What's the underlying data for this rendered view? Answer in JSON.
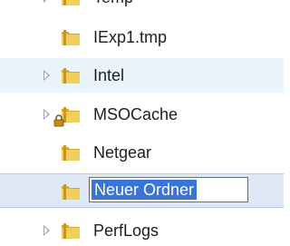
{
  "folders": [
    {
      "name": "Temp",
      "expandable": true
    },
    {
      "name": "IExp1.tmp",
      "expandable": false
    },
    {
      "name": "Intel",
      "expandable": true
    },
    {
      "name": "MSOCache",
      "expandable": true,
      "locked": true
    },
    {
      "name": "Netgear",
      "expandable": false
    },
    {
      "name": "Neuer Ordner",
      "expandable": false,
      "renaming": true
    },
    {
      "name": "PerfLogs",
      "expandable": true
    }
  ],
  "colors": {
    "folder_body": "#e8c34a",
    "folder_tab": "#d9a82c",
    "hover_row": "#e9f3fc",
    "selected_row": "#dfe8f6",
    "rename_highlight": "#3a74d8"
  },
  "icons": {
    "folder": "folder-icon",
    "expander": "expand-arrow-icon",
    "lock": "lock-icon"
  }
}
